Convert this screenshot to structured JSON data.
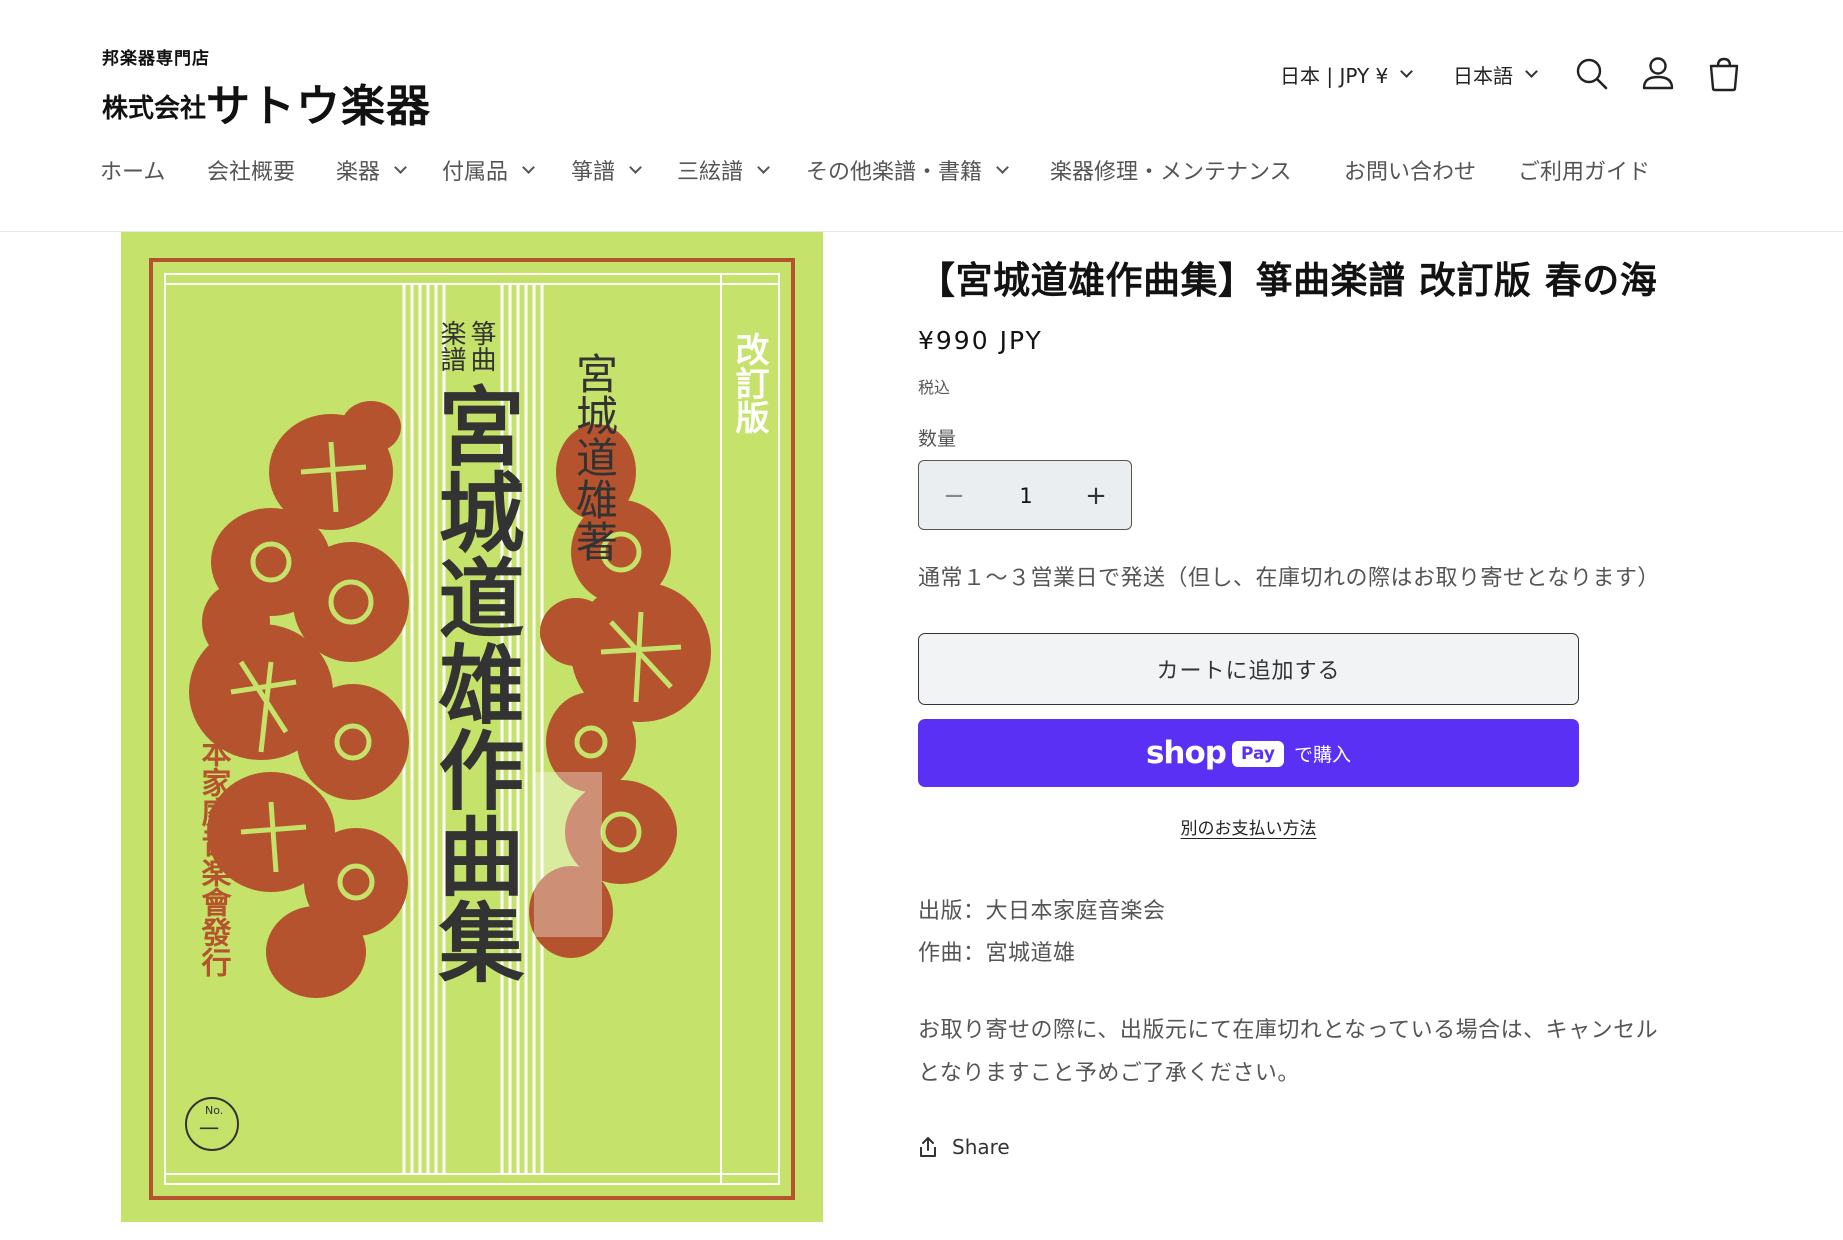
{
  "store": {
    "logo_sub": "邦楽器専門店",
    "logo_prefix": "株式会社",
    "logo_name": "サトウ楽器"
  },
  "header": {
    "currency": "日本 | JPY ¥",
    "language": "日本語",
    "icons": [
      "search-icon",
      "account-icon",
      "cart-icon"
    ]
  },
  "nav": {
    "items": [
      {
        "label": "ホーム",
        "dropdown": false
      },
      {
        "label": "会社概要",
        "dropdown": false
      },
      {
        "label": "楽器",
        "dropdown": true
      },
      {
        "label": "付属品",
        "dropdown": true
      },
      {
        "label": "箏譜",
        "dropdown": true
      },
      {
        "label": "三絃譜",
        "dropdown": true
      },
      {
        "label": "その他楽譜・書籍",
        "dropdown": true
      },
      {
        "label": "楽器修理・メンテナンス",
        "dropdown": false
      },
      {
        "label": "お問い合わせ",
        "dropdown": false
      },
      {
        "label": "ご利用ガイド",
        "dropdown": false
      }
    ]
  },
  "cover": {
    "top_right": "改訂版",
    "series_left": "箏曲",
    "series_right": "楽譜",
    "main_title": "宮城道雄作曲集",
    "author": "宮城道雄著",
    "publisher": "大日本家庭音楽會發行",
    "no_mark": "No.",
    "no_value": "一",
    "colors": {
      "background": "#c5e26a",
      "ink": "#b4532e",
      "text": "#333333"
    }
  },
  "product": {
    "title": "【宮城道雄作曲集】箏曲楽譜 改訂版 春の海",
    "price": "¥990 JPY",
    "tax_note": "税込",
    "quantity_label": "数量",
    "quantity": "1",
    "minus": "−",
    "plus": "+",
    "shipping_note": "通常１～３営業日で発送（但し、在庫切れの際はお取り寄せとなります）",
    "add_to_cart": "カートに追加する",
    "shop_pay": {
      "shop": "shop",
      "pay": "Pay",
      "suffix": "で購入",
      "color": "#5a31f4"
    },
    "more_payment": "別のお支払い方法",
    "publisher_line": "出版：大日本家庭音楽会",
    "composer_line": "作曲：宮城道雄",
    "notice_line1": "お取り寄せの際に、出版元にて在庫切れとなっている場合は、キャンセル",
    "notice_line2": "となりますこと予めご了承ください。",
    "share": "Share"
  }
}
